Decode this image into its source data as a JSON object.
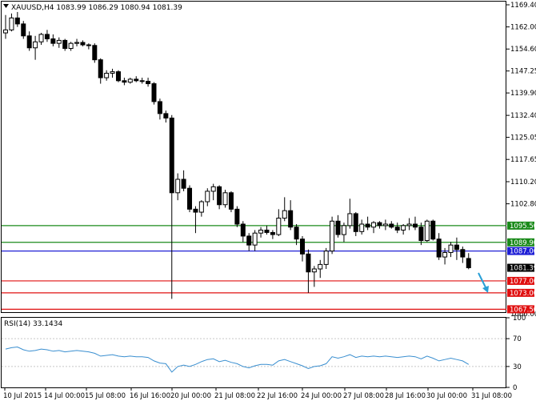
{
  "main_panel": {
    "title": "XAUUSD,H4",
    "ohlc": "1083.99 1086.29 1080.94 1081.39",
    "title_symbol_icon": "triangle-down-icon"
  },
  "price_scale": {
    "ticks": [
      "1169.40",
      "1162.00",
      "1154.60",
      "1147.25",
      "1139.90",
      "1132.40",
      "1125.05",
      "1117.65",
      "1110.20",
      "1102.80"
    ],
    "low_tick": "1066.00"
  },
  "levels": [
    {
      "label": "1095.50",
      "price": 1095.5,
      "color": "#1a8a1a"
    },
    {
      "label": "1089.90",
      "price": 1089.9,
      "color": "#1a8a1a"
    },
    {
      "label": "1087.00",
      "price": 1087.0,
      "color": "#1f1fd6"
    },
    {
      "label": "1077.00",
      "price": 1077.0,
      "color": "#e01010"
    },
    {
      "label": "1073.00",
      "price": 1073.0,
      "color": "#e01010"
    },
    {
      "label": "1067.50",
      "price": 1067.5,
      "color": "#e01010"
    }
  ],
  "current_price": {
    "label": "1081.39",
    "price": 1081.39
  },
  "rsi_panel": {
    "title": "RSI(14) 33.1434",
    "ticks": [
      "100",
      "70",
      "30",
      "0"
    ],
    "color": "#3a8fd0"
  },
  "time_axis": {
    "labels": [
      "10 Jul 2015",
      "14 Jul 00:00",
      "15 Jul 08:00",
      "16 Jul 16:00",
      "20 Jul 00:00",
      "21 Jul 08:00",
      "22 Jul 16:00",
      "24 Jul 00:00",
      "27 Jul 08:00",
      "28 Jul 16:00",
      "30 Jul 00:00",
      "31 Jul 08:00"
    ]
  },
  "arrow": {
    "icon": "down-arrow-icon",
    "color": "#2a9fd6"
  },
  "chart_data": {
    "type": "candlestick",
    "symbol": "XAUUSD",
    "timeframe": "H4",
    "candles": [
      [
        1160.0,
        1166.0,
        1158.0,
        1161.0
      ],
      [
        1161.0,
        1166.5,
        1160.5,
        1165.0
      ],
      [
        1165.0,
        1167.0,
        1162.0,
        1163.0
      ],
      [
        1163.0,
        1164.0,
        1158.0,
        1159.0
      ],
      [
        1159.0,
        1160.5,
        1154.0,
        1155.0
      ],
      [
        1155.0,
        1159.0,
        1151.0,
        1157.0
      ],
      [
        1157.0,
        1160.0,
        1156.0,
        1159.5
      ],
      [
        1159.5,
        1161.0,
        1157.0,
        1158.0
      ],
      [
        1158.0,
        1159.5,
        1155.5,
        1156.5
      ],
      [
        1156.5,
        1158.5,
        1155.0,
        1157.5
      ],
      [
        1157.5,
        1158.0,
        1154.0,
        1154.8
      ],
      [
        1154.8,
        1157.0,
        1154.0,
        1156.5
      ],
      [
        1156.5,
        1158.0,
        1155.5,
        1156.8
      ],
      [
        1156.8,
        1157.5,
        1155.5,
        1156.0
      ],
      [
        1156.0,
        1156.5,
        1154.5,
        1155.8
      ],
      [
        1155.8,
        1156.5,
        1150.0,
        1151.0
      ],
      [
        1151.0,
        1151.5,
        1143.0,
        1145.0
      ],
      [
        1145.0,
        1147.5,
        1144.0,
        1146.5
      ],
      [
        1146.5,
        1148.0,
        1145.0,
        1147.0
      ],
      [
        1147.0,
        1147.5,
        1143.5,
        1144.0
      ],
      [
        1144.0,
        1145.0,
        1142.5,
        1143.5
      ],
      [
        1143.5,
        1145.0,
        1143.0,
        1144.5
      ],
      [
        1144.5,
        1145.5,
        1143.5,
        1144.0
      ],
      [
        1144.0,
        1145.0,
        1143.0,
        1143.8
      ],
      [
        1143.8,
        1145.0,
        1142.0,
        1143.0
      ],
      [
        1143.0,
        1143.5,
        1136.0,
        1137.0
      ],
      [
        1137.0,
        1138.0,
        1131.0,
        1133.0
      ],
      [
        1133.0,
        1134.0,
        1130.0,
        1131.5
      ],
      [
        1131.5,
        1132.5,
        1071.0,
        1106.5
      ],
      [
        1106.5,
        1113.0,
        1104.0,
        1111.0
      ],
      [
        1111.0,
        1114.0,
        1107.0,
        1108.0
      ],
      [
        1108.0,
        1109.0,
        1100.0,
        1101.0
      ],
      [
        1101.0,
        1102.0,
        1093.0,
        1100.0
      ],
      [
        1100.0,
        1104.0,
        1098.5,
        1103.5
      ],
      [
        1103.5,
        1108.0,
        1102.0,
        1107.0
      ],
      [
        1107.0,
        1109.5,
        1104.0,
        1108.5
      ],
      [
        1108.5,
        1109.0,
        1101.0,
        1102.5
      ],
      [
        1102.5,
        1107.5,
        1101.5,
        1106.5
      ],
      [
        1106.5,
        1107.0,
        1100.0,
        1101.0
      ],
      [
        1101.0,
        1102.0,
        1095.0,
        1096.0
      ],
      [
        1096.0,
        1097.0,
        1090.0,
        1092.0
      ],
      [
        1092.0,
        1093.0,
        1087.0,
        1089.0
      ],
      [
        1089.0,
        1094.0,
        1087.0,
        1093.0
      ],
      [
        1093.0,
        1095.0,
        1091.5,
        1094.0
      ],
      [
        1094.0,
        1095.5,
        1092.5,
        1093.2
      ],
      [
        1093.2,
        1094.0,
        1091.0,
        1092.5
      ],
      [
        1092.5,
        1101.0,
        1092.0,
        1098.0
      ],
      [
        1098.0,
        1105.0,
        1097.0,
        1100.5
      ],
      [
        1100.5,
        1104.0,
        1094.0,
        1095.0
      ],
      [
        1095.0,
        1096.0,
        1089.0,
        1091.0
      ],
      [
        1091.0,
        1092.0,
        1083.5,
        1086.0
      ],
      [
        1086.0,
        1087.5,
        1073.0,
        1080.0
      ],
      [
        1080.0,
        1082.0,
        1075.0,
        1081.0
      ],
      [
        1081.0,
        1084.0,
        1078.0,
        1082.5
      ],
      [
        1082.5,
        1088.0,
        1081.0,
        1087.0
      ],
      [
        1087.0,
        1098.5,
        1086.0,
        1097.0
      ],
      [
        1097.0,
        1099.0,
        1091.5,
        1092.5
      ],
      [
        1092.5,
        1096.5,
        1090.0,
        1095.5
      ],
      [
        1095.5,
        1104.5,
        1094.5,
        1099.5
      ],
      [
        1099.5,
        1100.0,
        1092.0,
        1093.5
      ],
      [
        1093.5,
        1097.5,
        1092.5,
        1096.0
      ],
      [
        1096.0,
        1098.5,
        1094.0,
        1095.0
      ],
      [
        1095.0,
        1097.0,
        1093.0,
        1096.5
      ],
      [
        1096.5,
        1097.0,
        1094.5,
        1095.5
      ],
      [
        1095.5,
        1097.5,
        1094.0,
        1096.0
      ],
      [
        1096.0,
        1097.0,
        1094.5,
        1095.0
      ],
      [
        1095.0,
        1096.5,
        1093.0,
        1094.0
      ],
      [
        1094.0,
        1096.0,
        1092.5,
        1095.5
      ],
      [
        1095.5,
        1098.0,
        1094.0,
        1096.0
      ],
      [
        1096.0,
        1098.5,
        1094.0,
        1095.0
      ],
      [
        1095.0,
        1096.5,
        1089.0,
        1090.5
      ],
      [
        1090.5,
        1097.5,
        1090.0,
        1097.0
      ],
      [
        1097.0,
        1097.5,
        1090.5,
        1091.0
      ],
      [
        1091.0,
        1093.0,
        1084.0,
        1085.0
      ],
      [
        1085.0,
        1088.0,
        1082.5,
        1086.5
      ],
      [
        1086.5,
        1090.0,
        1085.0,
        1089.0
      ],
      [
        1089.0,
        1091.5,
        1084.0,
        1087.5
      ],
      [
        1087.5,
        1088.5,
        1083.0,
        1085.0
      ],
      [
        1084.5,
        1086.3,
        1080.9,
        1081.4
      ]
    ],
    "rsi": [
      55,
      57,
      58,
      54,
      52,
      53,
      55,
      54,
      52,
      53,
      51,
      52,
      53,
      52,
      51,
      49,
      45,
      46,
      47,
      45,
      44,
      45,
      44,
      44,
      43,
      38,
      35,
      34,
      22,
      30,
      32,
      30,
      33,
      37,
      40,
      41,
      37,
      39,
      36,
      34,
      30,
      28,
      31,
      33,
      33,
      32,
      38,
      40,
      37,
      34,
      31,
      27,
      30,
      31,
      34,
      44,
      42,
      44,
      47,
      43,
      45,
      44,
      45,
      44,
      45,
      44,
      43,
      44,
      45,
      44,
      41,
      45,
      42,
      38,
      40,
      42,
      40,
      38,
      33
    ]
  }
}
